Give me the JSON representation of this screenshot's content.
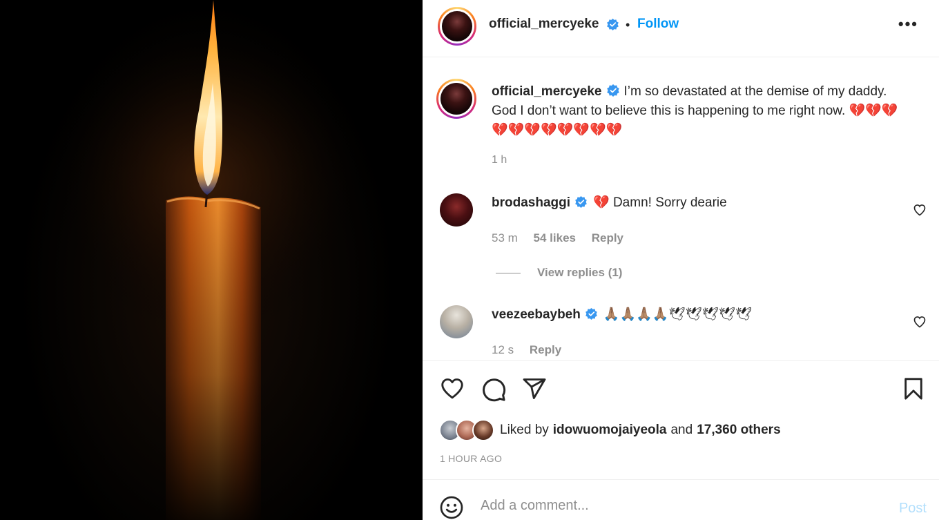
{
  "post": {
    "author": "official_mercyeke",
    "follow_label": "Follow",
    "separator": "•",
    "more_label": "•••",
    "caption_text": "I’m so devastated at the demise of my daddy. God I don’t want to believe this is happening to me right now. 💔💔💔💔💔💔💔💔💔💔💔",
    "caption_time": "1 h"
  },
  "comments": [
    {
      "username": "brodashaggi",
      "text": "💔 Damn! Sorry dearie",
      "time": "53 m",
      "likes": "54 likes",
      "reply_label": "Reply",
      "view_replies": "View replies (1)"
    },
    {
      "username": "veezeebaybeh",
      "text": "🙏🏽🙏🏽🙏🏽🙏🏽🕊🕊🕊🕊🕊",
      "time": "12 s",
      "reply_label": "Reply"
    }
  ],
  "engagement": {
    "liked_by_prefix": "Liked by",
    "liked_by_user": "idowuomojaiyeola",
    "liked_by_and": "and",
    "liked_by_others": "17,360 others",
    "time_ago": "1 HOUR AGO"
  },
  "comment_box": {
    "placeholder": "Add a comment...",
    "post_label": "Post"
  },
  "icons": {
    "header_more": "more-horizontal-icon",
    "like": "heart-icon",
    "comment": "comment-icon",
    "share": "paper-plane-icon",
    "save": "bookmark-icon",
    "emoji": "smiley-icon",
    "verified": "verified-badge-icon"
  },
  "colors": {
    "link_blue": "#0095f6",
    "verified_blue": "#3897f0",
    "muted_text": "#8e8e8e",
    "post_disabled": "#b2dffc"
  }
}
